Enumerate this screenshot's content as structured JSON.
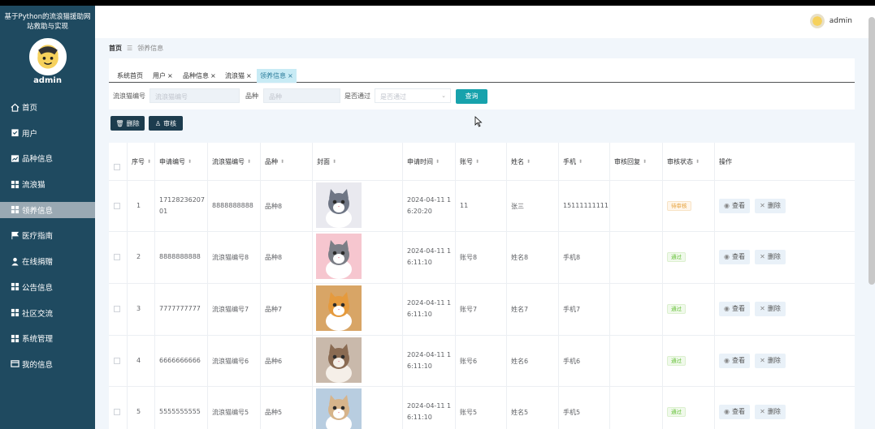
{
  "sidebar": {
    "title_line1": "基于Python的流浪猫援助网",
    "title_line2": "站救助与实现",
    "username": "admin",
    "items": [
      {
        "label": "首页",
        "icon": "home-icon"
      },
      {
        "label": "用户",
        "icon": "user-check-icon"
      },
      {
        "label": "品种信息",
        "icon": "chart-icon"
      },
      {
        "label": "流浪猫",
        "icon": "grid-icon"
      },
      {
        "label": "领养信息",
        "icon": "grid-icon",
        "active": true
      },
      {
        "label": "医疗指南",
        "icon": "flag-icon"
      },
      {
        "label": "在线捐赠",
        "icon": "person-icon"
      },
      {
        "label": "公告信息",
        "icon": "grid-icon"
      },
      {
        "label": "社区交流",
        "icon": "grid-icon"
      },
      {
        "label": "系统管理",
        "icon": "grid-icon"
      },
      {
        "label": "我的信息",
        "icon": "card-icon"
      }
    ]
  },
  "header": {
    "username": "admin"
  },
  "breadcrumb": {
    "home": "首页",
    "separator": "☰",
    "current": "领养信息"
  },
  "tabs": [
    {
      "label": "系统首页",
      "closable": false
    },
    {
      "label": "用户",
      "closable": true
    },
    {
      "label": "品种信息",
      "closable": true
    },
    {
      "label": "流浪猫",
      "closable": true
    },
    {
      "label": "领养信息",
      "closable": true,
      "active": true
    }
  ],
  "search": {
    "cat_no_label": "流浪猫编号",
    "cat_no_placeholder": "流浪猫编号",
    "breed_label": "品种",
    "breed_placeholder": "品种",
    "passed_label": "是否通过",
    "passed_placeholder": "是否通过",
    "query_button": "查询"
  },
  "actions": {
    "delete_label": "删除",
    "audit_label": "审核"
  },
  "table": {
    "headers": [
      "序号",
      "申请编号",
      "流浪猫编号",
      "品种",
      "封面",
      "申请时间",
      "账号",
      "姓名",
      "手机",
      "审核回复",
      "审核状态",
      "操作"
    ],
    "view_label": "查看",
    "delete_label": "删除",
    "rows": [
      {
        "index": "1",
        "app_no_1": "17128236207",
        "app_no_2": "01",
        "cat_no": "8888888888",
        "breed": "品种8",
        "time_1": "2024-04-11 1",
        "time_2": "6:20:20",
        "account": "11",
        "name": "张三",
        "phone": "15111111111",
        "reply": "",
        "status": "待审核",
        "status_type": "pending"
      },
      {
        "index": "2",
        "app_no_1": "8888888888",
        "app_no_2": "",
        "cat_no": "流浪猫编号8",
        "breed": "品种8",
        "time_1": "2024-04-11 1",
        "time_2": "6:11:10",
        "account": "账号8",
        "name": "姓名8",
        "phone": "手机8",
        "reply": "",
        "status": "通过",
        "status_type": "pass"
      },
      {
        "index": "3",
        "app_no_1": "7777777777",
        "app_no_2": "",
        "cat_no": "流浪猫编号7",
        "breed": "品种7",
        "time_1": "2024-04-11 1",
        "time_2": "6:11:10",
        "account": "账号7",
        "name": "姓名7",
        "phone": "手机7",
        "reply": "",
        "status": "通过",
        "status_type": "pass"
      },
      {
        "index": "4",
        "app_no_1": "6666666666",
        "app_no_2": "",
        "cat_no": "流浪猫编号6",
        "breed": "品种6",
        "time_1": "2024-04-11 1",
        "time_2": "6:11:10",
        "account": "账号6",
        "name": "姓名6",
        "phone": "手机6",
        "reply": "",
        "status": "通过",
        "status_type": "pass"
      },
      {
        "index": "5",
        "app_no_1": "5555555555",
        "app_no_2": "",
        "cat_no": "流浪猫编号5",
        "breed": "品种5",
        "time_1": "2024-04-11 1",
        "time_2": "6:11:10",
        "account": "账号5",
        "name": "姓名5",
        "phone": "手机5",
        "reply": "",
        "status": "通过",
        "status_type": "pass"
      }
    ]
  },
  "colors": {
    "sidebar_bg": "#1f4a60",
    "accent": "#17a2ac",
    "dark_button": "#1c3c4e"
  }
}
